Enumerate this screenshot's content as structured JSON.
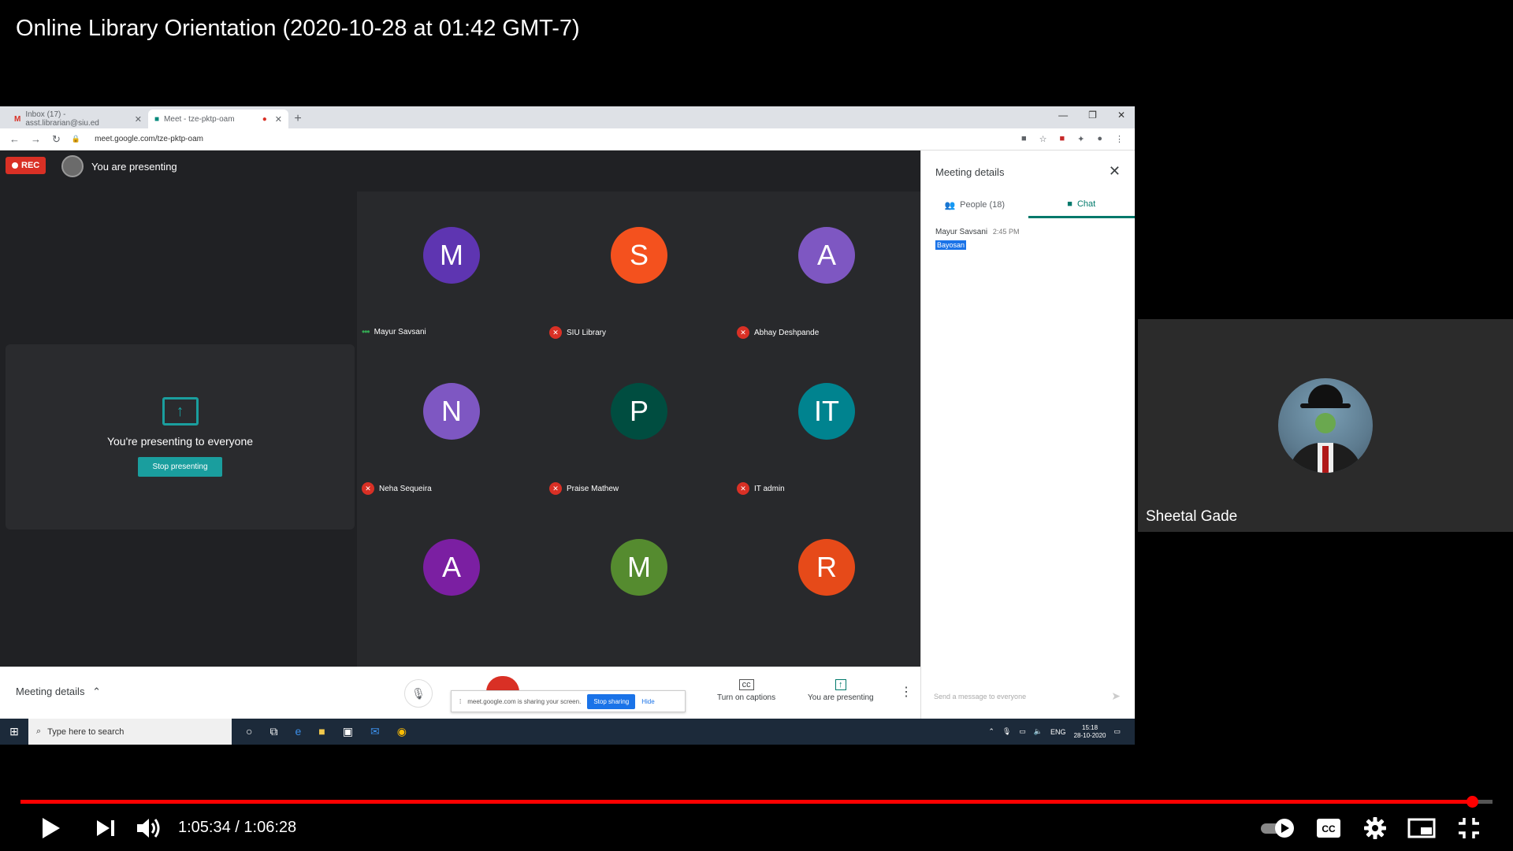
{
  "video_title": "Online Library Orientation (2020-10-28 at 01:42 GMT-7)",
  "browser": {
    "tabs": [
      {
        "label": "Inbox (17) - asst.librarian@siu.ed",
        "icon": "gmail-icon"
      },
      {
        "label": "Meet - tze-pktp-oam",
        "icon": "meet-icon",
        "recording": true
      }
    ],
    "new_tab_label": "+",
    "url": "meet.google.com/tze-pktp-oam"
  },
  "meet": {
    "rec_label": "REC",
    "presenting_label": "You are presenting",
    "present_card": {
      "text": "You're presenting to everyone",
      "button": "Stop presenting"
    },
    "participants": [
      {
        "initial": "M",
        "name": "Mayur Savsani",
        "color": "#5e35b1",
        "muted": false
      },
      {
        "initial": "S",
        "name": "SIU Library",
        "color": "#f4511e",
        "muted": true
      },
      {
        "initial": "A",
        "name": "Abhay Deshpande",
        "color": "#7e57c2",
        "muted": true
      },
      {
        "initial": "N",
        "name": "Neha Sequeira",
        "color": "#7e57c2",
        "muted": true
      },
      {
        "initial": "P",
        "name": "Praise Mathew",
        "color": "#004d40",
        "muted": true
      },
      {
        "initial": "IT",
        "name": "IT admin",
        "color": "#00838f",
        "muted": true
      },
      {
        "initial": "A",
        "name": "",
        "color": "#7b1fa2",
        "muted": false
      },
      {
        "initial": "M",
        "name": "",
        "color": "#558b2f",
        "muted": false
      },
      {
        "initial": "R",
        "name": "",
        "color": "#e64a19",
        "muted": false
      }
    ],
    "bottom": {
      "meeting_details": "Meeting details",
      "share_toast": "meet.google.com is sharing your screen.",
      "stop_sharing": "Stop sharing",
      "hide": "Hide",
      "captions": "Turn on captions",
      "you_presenting": "You are presenting"
    }
  },
  "side_panel": {
    "title": "Meeting details",
    "tab_people": "People (18)",
    "tab_chat": "Chat",
    "message_author": "Mayur Savsani",
    "message_time": "2:45 PM",
    "message_text": "Bayosan",
    "input_placeholder": "Send a message to everyone"
  },
  "taskbar": {
    "search_placeholder": "Type here to search",
    "lang": "ENG",
    "time": "15:18",
    "date": "28-10-2020"
  },
  "webcam": {
    "name": "Sheetal Gade"
  },
  "player": {
    "current_time": "1:05:34",
    "total_time": "1:06:28",
    "time_display": "1:05:34 / 1:06:28",
    "progress_fraction": 0.9859,
    "accent": "#ff0000"
  }
}
